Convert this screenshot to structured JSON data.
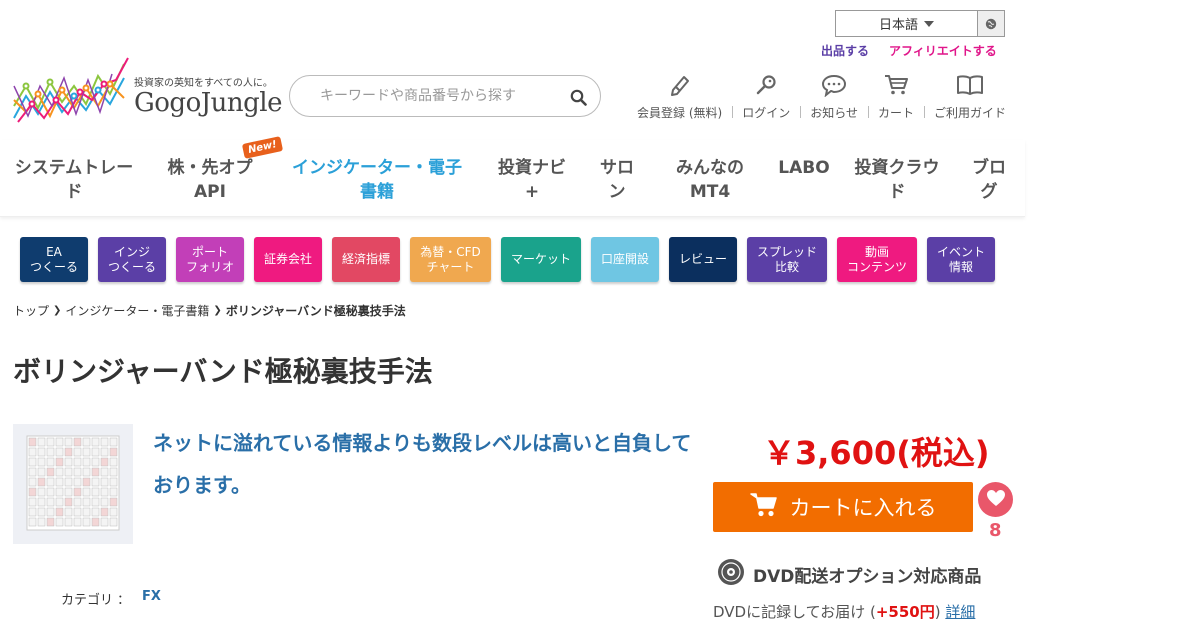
{
  "header": {
    "language": "日本語",
    "sell_link": "出品する",
    "affiliate_link": "アフィリエイトする",
    "logo": {
      "tagline": "投資家の英知をすべての人に。",
      "wordmark": "GogoJungle"
    },
    "search": {
      "placeholder": "キーワードや商品番号から探す"
    },
    "nav": [
      {
        "label": "会員登録 (無料)",
        "icon": "pencil-icon"
      },
      {
        "label": "ログイン",
        "icon": "key-icon"
      },
      {
        "label": "お知らせ",
        "icon": "speech-bubble-icon"
      },
      {
        "label": "カート",
        "icon": "cart-icon"
      },
      {
        "label": "ご利用ガイド",
        "icon": "book-icon"
      }
    ]
  },
  "main_nav": {
    "items": [
      {
        "line1": "システムトレー",
        "line2": "ド"
      },
      {
        "line1": "株・先オプ",
        "line2": "API"
      },
      {
        "line1": "インジケーター・電子",
        "line2": "書籍"
      },
      {
        "line1": "投資ナビ",
        "line2": "+"
      },
      {
        "line1": "サロ",
        "line2": "ン"
      },
      {
        "line1": "みんなの",
        "line2": "MT4"
      },
      {
        "line1": "LABO",
        "line2": ""
      },
      {
        "line1": "投資クラウ",
        "line2": "ド"
      },
      {
        "line1": "ブロ",
        "line2": "グ"
      }
    ],
    "new_badge": "New!"
  },
  "categories": [
    {
      "line1": "EA",
      "line2": "つくーる",
      "color": "#0f3c6e"
    },
    {
      "line1": "インジ",
      "line2": "つくーる",
      "color": "#5b3fa6"
    },
    {
      "line1": "ポート",
      "line2": "フォリオ",
      "color": "#c23fb8"
    },
    {
      "line1": "証券会社",
      "line2": "",
      "color": "#ef1a80"
    },
    {
      "line1": "経済指標",
      "line2": "",
      "color": "#e24863"
    },
    {
      "line1": "為替・CFD",
      "line2": "チャート",
      "color": "#f0a84f"
    },
    {
      "line1": "マーケット",
      "line2": "",
      "color": "#1aa38c"
    },
    {
      "line1": "口座開設",
      "line2": "",
      "color": "#6fc6e3"
    },
    {
      "line1": "レビュー",
      "line2": "",
      "color": "#0b2f5e"
    },
    {
      "line1": "スプレッド",
      "line2": "比較",
      "color": "#5b3fa6"
    },
    {
      "line1": "動画",
      "line2": "コンテンツ",
      "color": "#ef1a80"
    },
    {
      "line1": "イベント",
      "line2": "情報",
      "color": "#5b3fa6"
    }
  ],
  "breadcrumb": {
    "items": [
      "トップ",
      "インジケーター・電子書籍"
    ],
    "current": "ボリンジャーバンド極秘裏技手法"
  },
  "product": {
    "title": "ボリンジャーバンド極秘裏技手法",
    "catchphrase": "ネットに溢れている情報よりも数段レベルは高いと自負しております。",
    "category_label": "カテゴリ ：",
    "category_value": "FX",
    "price": "￥3,600(税込)",
    "cart_button": "カートに入れる",
    "favorite_count": "8",
    "dvd": {
      "title": "DVD配送オプション対応商品",
      "note_prefix": "DVDに記録してお届け (",
      "note_price": "+550円",
      "note_suffix": ") ",
      "detail_link": "詳細"
    }
  },
  "colors": {
    "accent_blue": "#2ba0d8",
    "price_red": "#e01212",
    "cart_orange": "#f26d00",
    "favorite_pink": "#e9576a",
    "link_blue": "#2a6fa8"
  }
}
